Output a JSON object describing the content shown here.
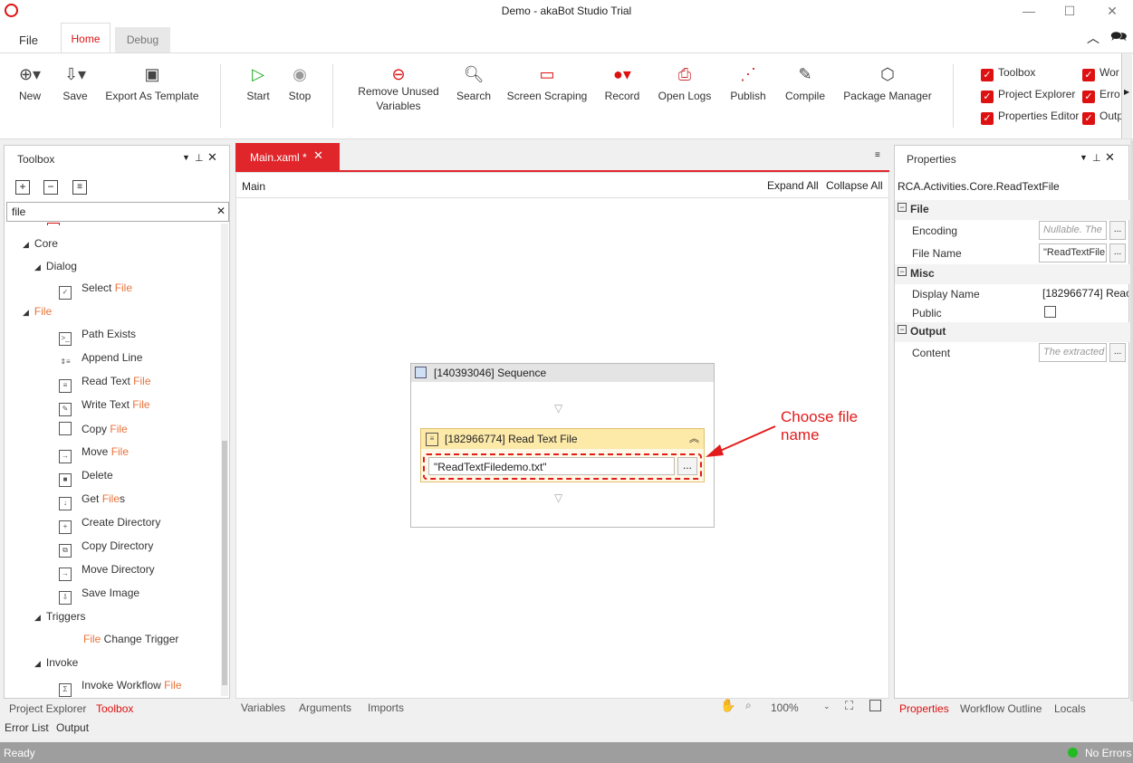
{
  "window": {
    "title": "Demo - akaBot Studio Trial"
  },
  "ribbon_tabs": [
    "File",
    "Home",
    "Debug"
  ],
  "ribbon_buttons": {
    "new": "New",
    "save": "Save",
    "export_template": "Export As Template",
    "start": "Start",
    "stop": "Stop",
    "remove_unused_1": "Remove Unused",
    "remove_unused_2": "Variables",
    "search": "Search",
    "screen_scraping": "Screen Scraping",
    "record": "Record",
    "open_logs": "Open Logs",
    "publish": "Publish",
    "compile": "Compile",
    "package_manager": "Package Manager"
  },
  "view_checks": {
    "toolbox": "Toolbox",
    "project_explorer": "Project Explorer",
    "properties_editor": "Properties Editor",
    "wor": "Wor",
    "erro": "Erro",
    "outp": "Outp"
  },
  "toolbox": {
    "title": "Toolbox",
    "search_value": "file",
    "core": "Core",
    "dialog": "Dialog",
    "select_file_a": "Select ",
    "select_file_b": "File",
    "file_group": "File",
    "items": {
      "path_exists": "Path Exists",
      "append_line": "Append Line",
      "read_text_a": "Read Text ",
      "read_text_b": "File",
      "write_text_a": "Write Text ",
      "write_text_b": "File",
      "copy_a": "Copy ",
      "copy_b": "File",
      "move_a": "Move ",
      "move_b": "File",
      "delete": "Delete",
      "get_files_a": "Get ",
      "get_files_b": "File",
      "get_files_c": "s",
      "create_directory": "Create Directory",
      "copy_directory": "Copy Directory",
      "move_directory": "Move Directory",
      "save_image": "Save Image"
    },
    "triggers": "Triggers",
    "file_change_a": "File",
    "file_change_b": " Change Trigger",
    "invoke": "Invoke",
    "invoke_wf_a": "Invoke Workflow ",
    "invoke_wf_b": "File"
  },
  "left_bottom_tabs": {
    "project_explorer": "Project Explorer",
    "toolbox": "Toolbox"
  },
  "bottom_tabs": {
    "error_list": "Error List",
    "output": "Output"
  },
  "designer": {
    "tab": "Main.xaml *",
    "breadcrumb": "Main",
    "expand_all": "Expand All",
    "collapse_all": "Collapse All",
    "sequence_title": "[140393046] Sequence",
    "activity_title": "[182966774] Read Text File",
    "file_value": "\"ReadTextFiledemo.txt\"",
    "annotation": "Choose file name",
    "bottom": {
      "variables": "Variables",
      "arguments": "Arguments",
      "imports": "Imports",
      "zoom": "100%"
    }
  },
  "properties": {
    "title": "Properties",
    "type": "RCA.Activities.Core.ReadTextFile",
    "sec_file": "File",
    "encoding_label": "Encoding",
    "encoding_placeholder": "Nullable. The",
    "filename_label": "File Name",
    "filename_value": "\"ReadTextFile",
    "sec_misc": "Misc",
    "display_name_label": "Display Name",
    "display_name_value": "[182966774] Reac",
    "public_label": "Public",
    "sec_output": "Output",
    "content_label": "Content",
    "content_placeholder": "The extracted",
    "tabs": {
      "properties": "Properties",
      "workflow_outline": "Workflow Outline",
      "locals": "Locals"
    }
  },
  "status": {
    "left": "Ready",
    "right": "No Errors"
  },
  "colors": {
    "accent": "#dd1f26",
    "annotation": "#e21c1c",
    "ok": "#22bb22"
  }
}
